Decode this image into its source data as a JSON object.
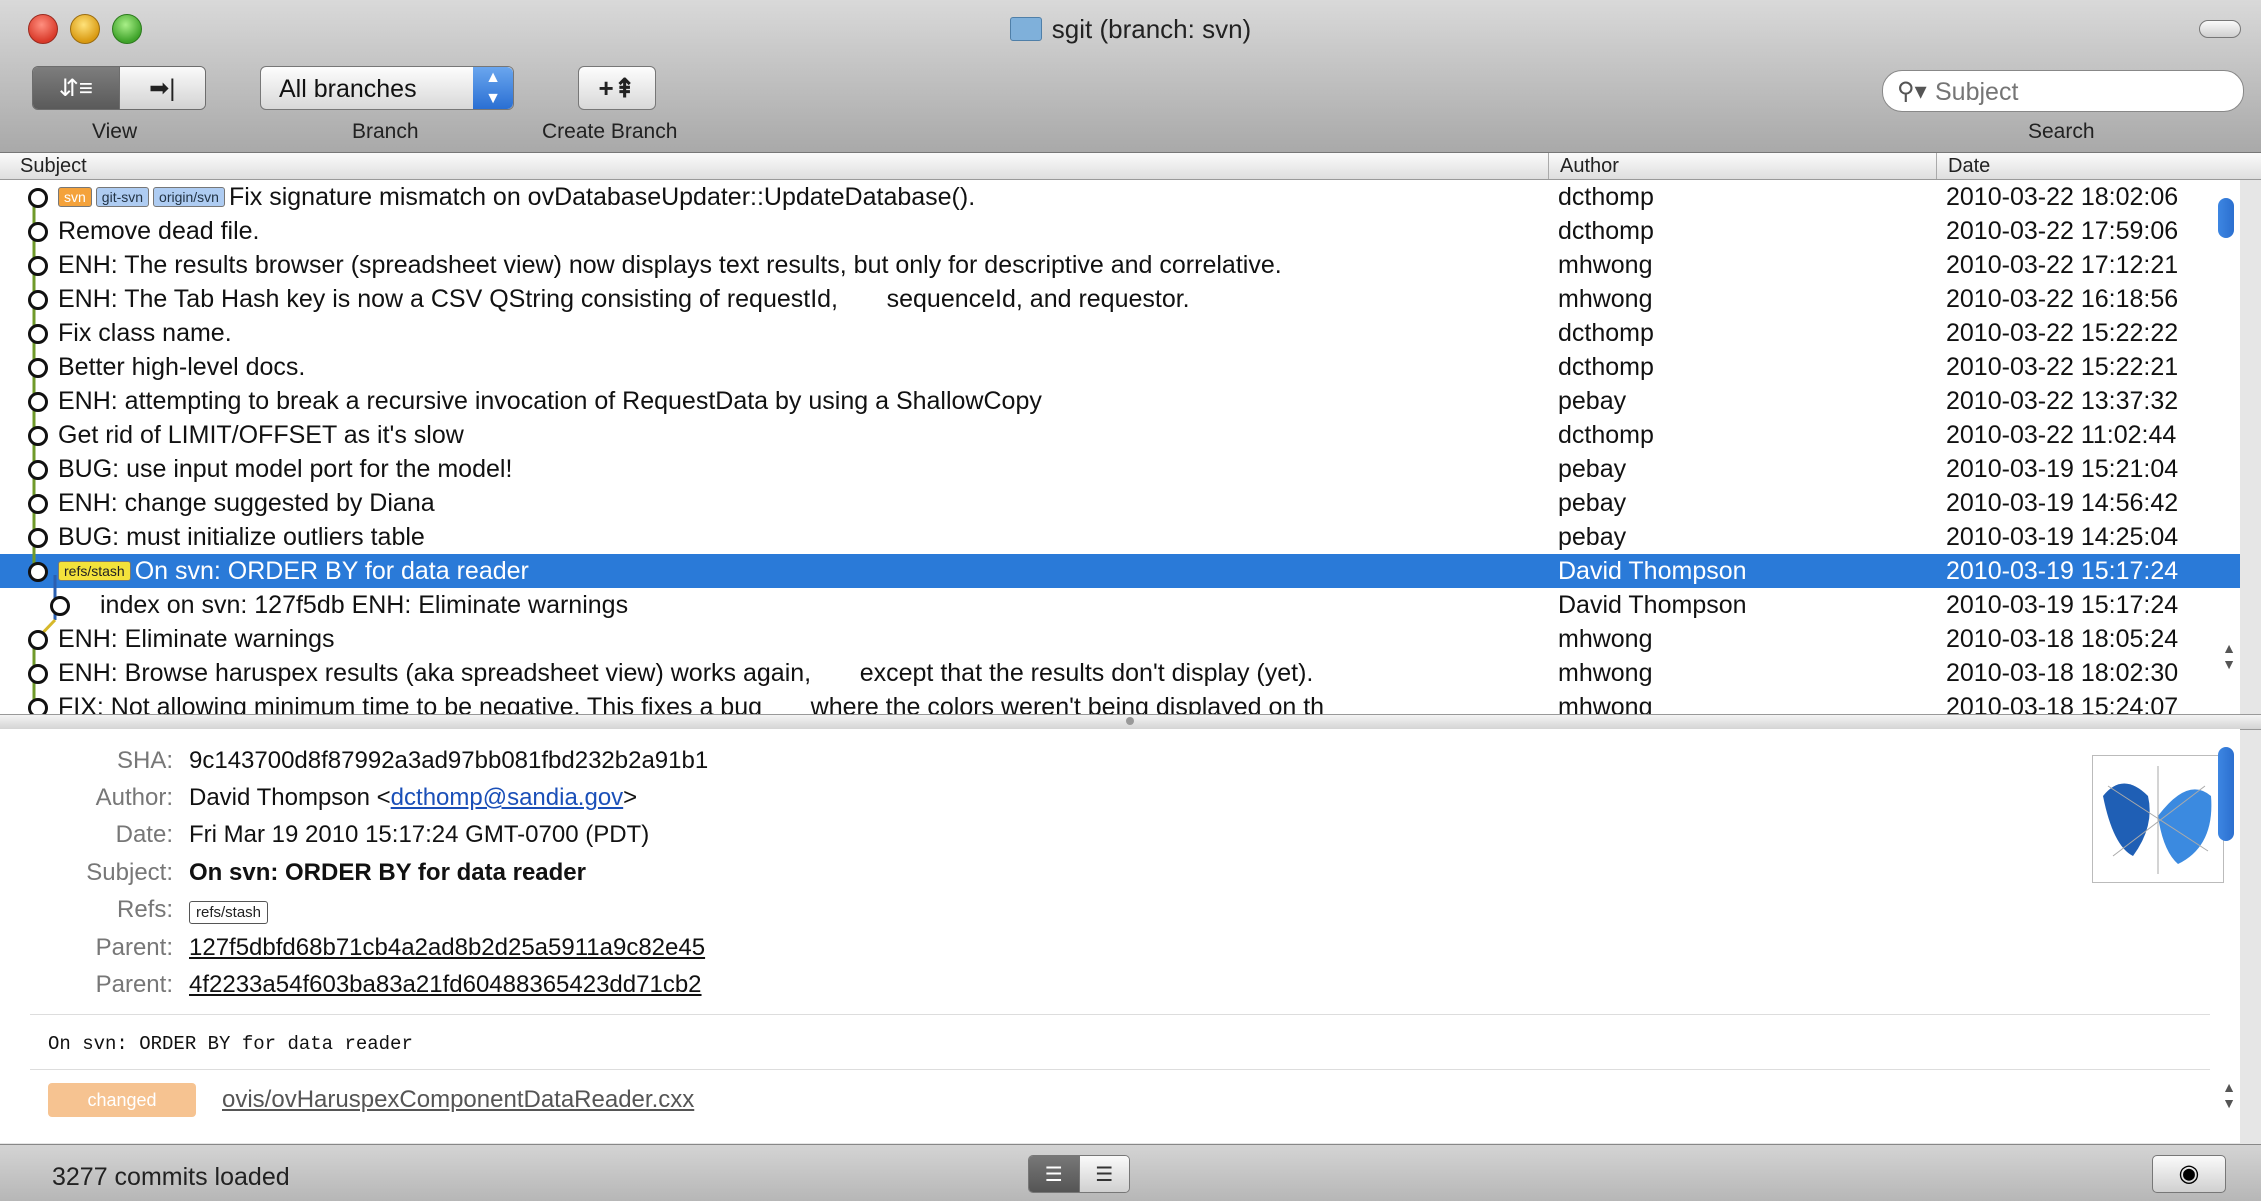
{
  "window": {
    "title": "sgit (branch: svn)"
  },
  "toolbar": {
    "view_caption": "View",
    "branch_caption": "Branch",
    "branch_value": "All branches",
    "create_caption": "Create Branch",
    "search_caption": "Search",
    "search_placeholder": "Subject"
  },
  "columns": {
    "subject": "Subject",
    "author": "Author",
    "date": "Date"
  },
  "commits": [
    {
      "refs": [
        "svn",
        "git-svn",
        "origin/svn"
      ],
      "subject": "Fix signature mismatch on ovDatabaseUpdater::UpdateDatabase().",
      "author": "dcthomp",
      "date": "2010-03-22 18:02:06"
    },
    {
      "refs": [],
      "subject": "Remove dead file.",
      "author": "dcthomp",
      "date": "2010-03-22 17:59:06"
    },
    {
      "refs": [],
      "subject": "ENH: The results browser (spreadsheet view) now displays text results, but only for descriptive and correlative.",
      "author": "mhwong",
      "date": "2010-03-22 17:12:21"
    },
    {
      "refs": [],
      "subject": "ENH: The Tab Hash key is now a CSV QString consisting of requestId,       sequenceId, and requestor.",
      "author": "mhwong",
      "date": "2010-03-22 16:18:56"
    },
    {
      "refs": [],
      "subject": "Fix class name.",
      "author": "dcthomp",
      "date": "2010-03-22 15:22:22"
    },
    {
      "refs": [],
      "subject": "Better high-level docs.",
      "author": "dcthomp",
      "date": "2010-03-22 15:22:21"
    },
    {
      "refs": [],
      "subject": "ENH: attempting to break a recursive invocation of RequestData by using a ShallowCopy",
      "author": "pebay",
      "date": "2010-03-22 13:37:32"
    },
    {
      "refs": [],
      "subject": "Get rid of LIMIT/OFFSET as it's slow",
      "author": "dcthomp",
      "date": "2010-03-22 11:02:44"
    },
    {
      "refs": [],
      "subject": "BUG: use input model port for the model!",
      "author": "pebay",
      "date": "2010-03-19 15:21:04"
    },
    {
      "refs": [],
      "subject": "ENH: change suggested by Diana",
      "author": "pebay",
      "date": "2010-03-19 14:56:42"
    },
    {
      "refs": [],
      "subject": "BUG: must initialize outliers table",
      "author": "pebay",
      "date": "2010-03-19 14:25:04"
    },
    {
      "refs": [
        "refs/stash"
      ],
      "subject": "On svn: ORDER BY for data reader",
      "author": "David Thompson",
      "date": "2010-03-19 15:17:24",
      "selected": true
    },
    {
      "refs": [],
      "subject": "index on svn: 127f5db ENH: Eliminate warnings",
      "author": "David Thompson",
      "date": "2010-03-19 15:17:24"
    },
    {
      "refs": [],
      "subject": "ENH: Eliminate warnings",
      "author": "mhwong",
      "date": "2010-03-18 18:05:24"
    },
    {
      "refs": [],
      "subject": "ENH: Browse haruspex results (aka spreadsheet view) works again,       except that the results don't display (yet).",
      "author": "mhwong",
      "date": "2010-03-18 18:02:30"
    },
    {
      "refs": [],
      "subject": "FIX: Not allowing minimum time to be negative. This fixes a bug       where the colors weren't being displayed on th",
      "author": "mhwong",
      "date": "2010-03-18 15:24:07"
    }
  ],
  "detail": {
    "sha_label": "SHA:",
    "sha": "9c143700d8f87992a3ad97bb081fbd232b2a91b1",
    "author_label": "Author:",
    "author_name": "David Thompson <",
    "author_email": "dcthomp@sandia.gov",
    "author_close": ">",
    "date_label": "Date:",
    "date": "Fri Mar 19 2010 15:17:24 GMT-0700 (PDT)",
    "subject_label": "Subject:",
    "subject": "On svn: ORDER BY for data reader",
    "refs_label": "Refs:",
    "refs": "refs/stash",
    "parent_label": "Parent:",
    "parent1": "127f5dbfd68b71cb4a2ad8b2d25a5911a9c82e45",
    "parent2": "4f2233a54f603ba83a21fd60488365423dd71cb2",
    "message": "On svn: ORDER BY for data reader",
    "change_type": "changed",
    "file": "ovis/ovHaruspexComponentDataReader.cxx"
  },
  "status": {
    "text": "3277 commits loaded"
  },
  "icons": {
    "view_list": "list-view-icon",
    "view_next": "next-arrow-icon",
    "create_branch": "create-branch-icon",
    "search": "search-icon",
    "eye": "eye-icon"
  }
}
